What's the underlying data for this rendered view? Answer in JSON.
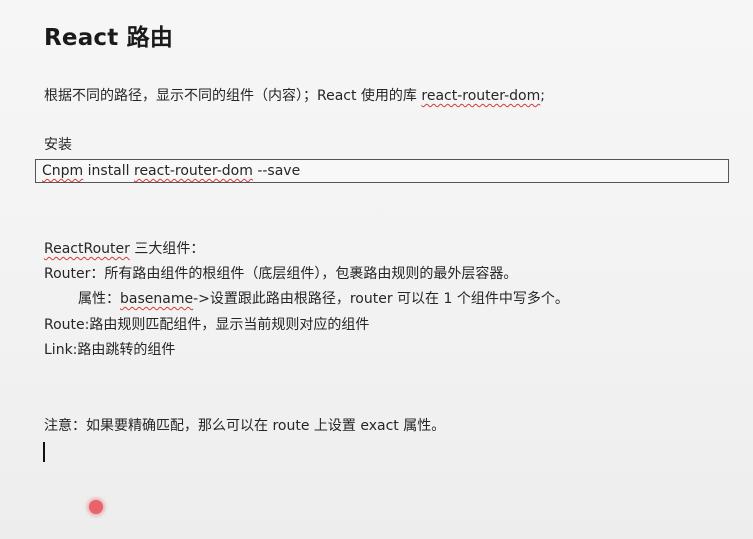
{
  "doc": {
    "title": "React  路由",
    "intro": {
      "prefix": "根据不同的路径，显示不同的组件（内容）；React 使用的库 ",
      "lib": "react-router-dom",
      "suffix": ";"
    },
    "install_heading": "安装",
    "install_cmd": {
      "cnpm": "Cnpm",
      "mid": " install ",
      "pkg": "react-router-dom",
      "flag": " --save"
    },
    "components": {
      "heading_word": "ReactRouter",
      "heading_rest": " 三大组件：",
      "router": "Router：所有路由组件的根组件（底层组件），包裹路由规则的最外层容器。",
      "attr_prefix": "属性：",
      "attr_word": "basename",
      "attr_rest": "->设置跟此路由根路径，router 可以在 1 个组件中写多个。",
      "route": "Route:路由规则匹配组件，显示当前规则对应的组件",
      "link": "Link:路由跳转的组件"
    },
    "note": "注意：如果要精确匹配，那么可以在 route 上设置 exact 属性。"
  },
  "colors": {
    "background": "#f2f2f2",
    "spellcheck": "#d23a3a",
    "pointer": "#e8636a"
  }
}
